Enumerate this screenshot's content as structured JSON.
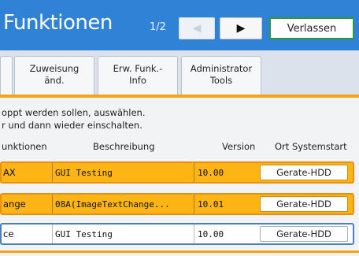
{
  "header": {
    "title": "Funktionen",
    "page_indicator": "1/2",
    "prev_icon": "◀",
    "next_icon": "▶",
    "exit_label": "Verlassen"
  },
  "tabs": [
    {
      "label": ""
    },
    {
      "label_line1": "Zuweisung",
      "label_line2": "änd."
    },
    {
      "label_line1": "Erw. Funk.-",
      "label_line2": "Info"
    },
    {
      "label_line1": "Administrator",
      "label_line2": "Tools"
    }
  ],
  "instructions": {
    "line1": "oppt werden sollen, auswählen.",
    "line2": "r und dann wieder einschalten."
  },
  "columns": {
    "name": "unktionen",
    "description": "Beschreibung",
    "version": "Version",
    "location": "Ort Systemstart"
  },
  "rows": [
    {
      "name": "AX",
      "description": "GUI Testing",
      "version": "10.00",
      "location": "Gerate-HDD",
      "selected": true
    },
    {
      "name": "ange",
      "description": "08A(ImageTextChange...",
      "version": "10.01",
      "location": "Gerate-HDD",
      "selected": true
    },
    {
      "name": "ce",
      "description": "GUI Testing",
      "version": "10.00",
      "location": "Gerate-HDD",
      "selected": false
    }
  ],
  "colors": {
    "header_blue": "#2f82d6",
    "accent_orange": "#fdb515",
    "exit_green": "#2f9a37"
  }
}
